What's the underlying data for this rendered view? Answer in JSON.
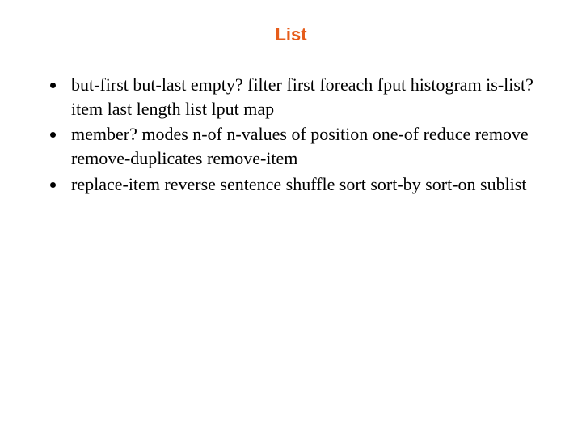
{
  "title": "List",
  "items": [
    "but-first but-last empty? filter first foreach fput histogram is-list? item last length list lput map",
    "member? modes n-of n-values of position one-of reduce remove remove-duplicates remove-item",
    "replace-item reverse sentence shuffle sort sort-by sort-on sublist"
  ]
}
